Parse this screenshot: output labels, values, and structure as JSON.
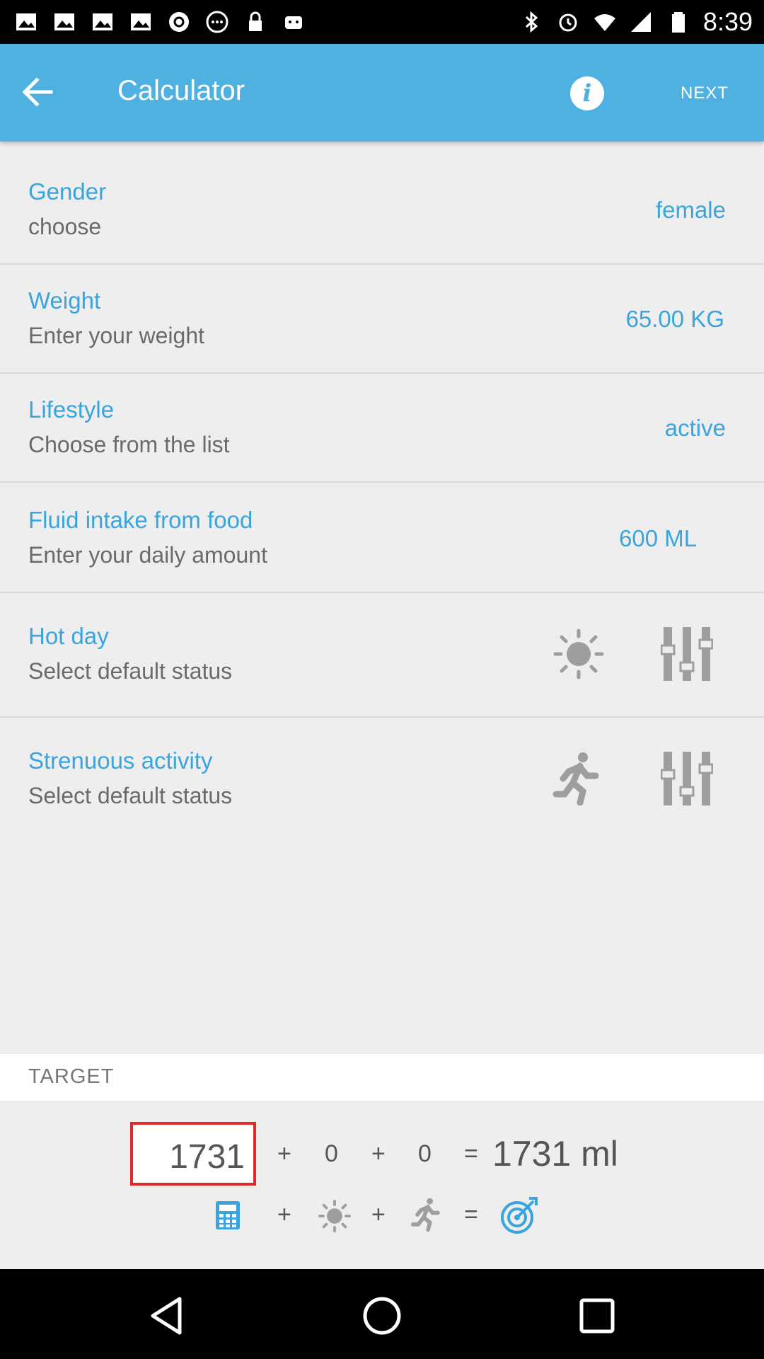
{
  "status_bar": {
    "time": "8:39",
    "notification_icons": [
      "image-icon",
      "image-icon",
      "image-icon",
      "image-icon",
      "at-sign-icon",
      "more-circle-icon",
      "lock-icon",
      "android-icon"
    ],
    "system_icons": [
      "bluetooth-icon",
      "alarm-icon",
      "wifi-icon",
      "signal-icon",
      "battery-icon"
    ]
  },
  "app_bar": {
    "title": "Calculator",
    "next_label": "NEXT",
    "info_glyph": "i",
    "background": "#4eb1e2"
  },
  "rows": [
    {
      "title": "Gender",
      "subtitle": "choose",
      "value": "female"
    },
    {
      "title": "Weight",
      "subtitle": "Enter your weight",
      "value": "65.00 KG"
    },
    {
      "title": "Lifestyle",
      "subtitle": "Choose from the list",
      "value": "active"
    },
    {
      "title": "Fluid intake from food",
      "subtitle": "Enter your daily amount",
      "value": "600 ML"
    },
    {
      "title": "Hot day",
      "subtitle": "Select default status",
      "icon": "sun-icon",
      "control": "sliders-icon"
    },
    {
      "title": "Strenuous activity",
      "subtitle": "Select default status",
      "icon": "runner-icon",
      "control": "sliders-icon"
    }
  ],
  "target": {
    "label": "TARGET",
    "base": "1731",
    "plus1": "+",
    "hot_day_add": "0",
    "plus2": "+",
    "activity_add": "0",
    "equals": "=",
    "result": "1731 ml",
    "legend_icons": [
      "calculator-icon",
      "sun-icon",
      "runner-icon",
      "target-icon"
    ]
  },
  "colors": {
    "accent": "#3aa4de",
    "highlight_border": "#e02a2a"
  }
}
